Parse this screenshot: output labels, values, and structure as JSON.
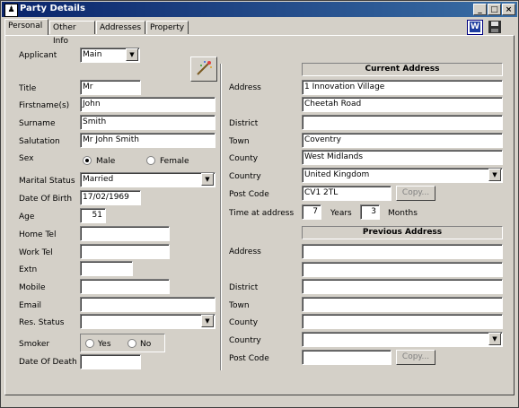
{
  "window": {
    "title": "Party Details",
    "minimize": "_",
    "maximize": "□",
    "close": "×"
  },
  "tabs": [
    "Personal",
    "Other Info",
    "Addresses",
    "Property"
  ],
  "toolbar": {
    "word_icon": "W",
    "save_icon": "floppy"
  },
  "personal": {
    "applicant_label": "Applicant",
    "applicant_value": "Main",
    "title_label": "Title",
    "title_value": "Mr",
    "firstnames_label": "Firstname(s)",
    "firstnames_value": "John",
    "surname_label": "Surname",
    "surname_value": "Smith",
    "salutation_label": "Salutation",
    "salutation_value": "Mr John Smith",
    "sex_label": "Sex",
    "sex_male": "Male",
    "sex_female": "Female",
    "marital_label": "Marital Status",
    "marital_value": "Married",
    "dob_label": "Date Of Birth",
    "dob_value": "17/02/1969",
    "age_label": "Age",
    "age_value": "51",
    "hometel_label": "Home Tel",
    "hometel_value": "",
    "worktel_label": "Work Tel",
    "worktel_value": "",
    "extn_label": "Extn",
    "extn_value": "",
    "mobile_label": "Mobile",
    "mobile_value": "",
    "email_label": "Email",
    "email_value": "",
    "resstatus_label": "Res. Status",
    "resstatus_value": "",
    "smoker_label": "Smoker",
    "smoker_yes": "Yes",
    "smoker_no": "No",
    "dod_label": "Date Of Death",
    "dod_value": ""
  },
  "current_address": {
    "header": "Current Address",
    "address_label": "Address",
    "line1": "1 Innovation Village",
    "line2": "Cheetah Road",
    "district_label": "District",
    "district": "",
    "town_label": "Town",
    "town": "Coventry",
    "county_label": "County",
    "county": "West Midlands",
    "country_label": "Country",
    "country": "United Kingdom",
    "postcode_label": "Post Code",
    "postcode": "CV1 2TL",
    "copy_label": "Copy...",
    "time_label": "Time at address",
    "years_value": "7",
    "years_label": "Years",
    "months_value": "3",
    "months_label": "Months"
  },
  "previous_address": {
    "header": "Previous Address",
    "address_label": "Address",
    "line1": "",
    "line2": "",
    "district_label": "District",
    "district": "",
    "town_label": "Town",
    "town": "",
    "county_label": "County",
    "county": "",
    "country_label": "Country",
    "country": "",
    "postcode_label": "Post Code",
    "postcode": "",
    "copy_label": "Copy..."
  }
}
